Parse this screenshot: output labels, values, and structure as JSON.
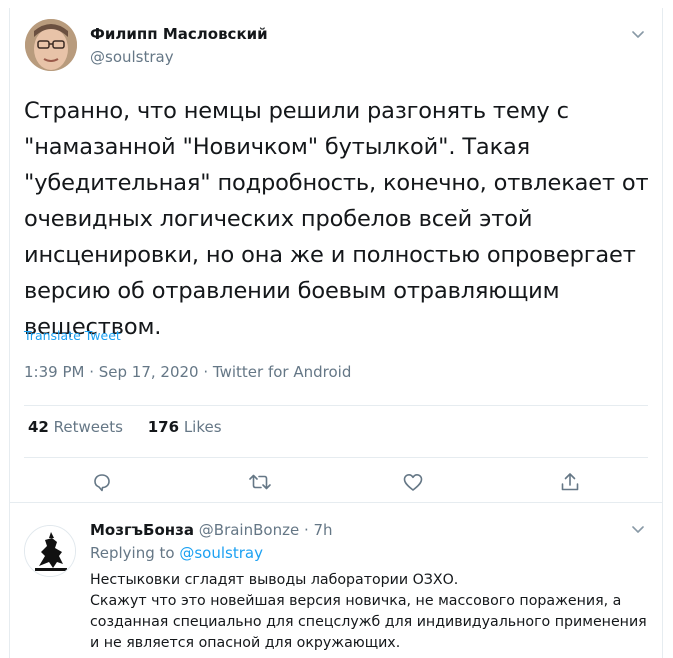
{
  "tweet": {
    "author_name": "Филипп Масловский",
    "author_handle": "@soulstray",
    "text": "Странно, что немцы решили разгонять тему с \"намазанной \"Новичком\" бутылкой\". Такая \"убедительная\" подробность, конечно, отвлекает от очевидных логических пробелов всей этой инсценировки, но она же и полностью опровергает версию об отравлении боевым отравляющим веществом.",
    "translate_label": "Translate Tweet",
    "time": "1:39 PM",
    "date": "Sep 17, 2020",
    "source": "Twitter for Android",
    "meta_sep": " · ",
    "retweets_count": "42",
    "retweets_label": "Retweets",
    "likes_count": "176",
    "likes_label": "Likes"
  },
  "reply": {
    "author_name": "МозгъБонза",
    "author_handle": "@BrainBonze",
    "dot": " · ",
    "age": "7h",
    "replying_prefix": "Replying to ",
    "replying_to": "@soulstray",
    "lines": [
      "Нестыковки сгладят выводы лаборатории ОЗХО.",
      "Скажут что это новейшая версия новичка, не массового поражения, а",
      "созданная специально для спецслужб для индивидуального применения",
      "и не является опасной для окружающих."
    ]
  },
  "icons": {
    "caret": "chevron-down-icon",
    "reply": "reply-icon",
    "retweet": "retweet-icon",
    "like": "heart-icon",
    "share": "share-icon"
  },
  "colors": {
    "text": "#14171a",
    "secondary": "#657786",
    "link": "#1da1f2",
    "border": "#e6ecf0"
  }
}
